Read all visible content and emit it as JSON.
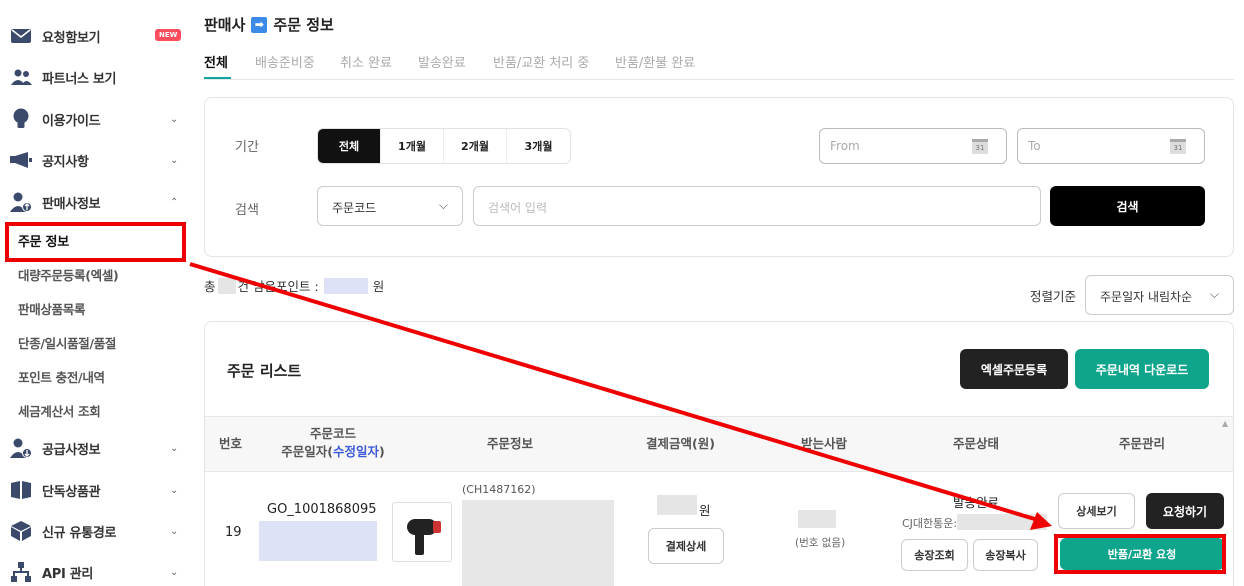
{
  "sidebar": {
    "items": [
      {
        "label": "요청함보기",
        "icon": "envelope-icon",
        "badge": "NEW"
      },
      {
        "label": "파트너스 보기",
        "icon": "people-icon"
      },
      {
        "label": "이용가이드",
        "icon": "lightbulb-icon",
        "chevron": "⌄"
      },
      {
        "label": "공지사항",
        "icon": "megaphone-icon",
        "chevron": "⌄"
      },
      {
        "label": "판매사정보",
        "icon": "user-up-icon",
        "chevron": "⌃"
      },
      {
        "label": "공급사정보",
        "icon": "user-down-icon",
        "chevron": "⌄"
      },
      {
        "label": "단독상품관",
        "icon": "bookmark-icon",
        "chevron": "⌄"
      },
      {
        "label": "신규 유통경로",
        "icon": "box-icon",
        "chevron": "⌄"
      },
      {
        "label": "API 관리",
        "icon": "network-icon",
        "chevron": "⌄"
      }
    ],
    "sub_items": [
      "주문 정보",
      "대량주문등록(엑셀)",
      "판매상품목록",
      "단종/일시품절/품절",
      "포인트 충전/내역",
      "세금계산서 조회"
    ]
  },
  "header": {
    "title_left": "판매사",
    "title_arrow": "➡",
    "title_right": "주문 정보"
  },
  "tabs": [
    "전체",
    "배송준비중",
    "취소 완료",
    "발송완료",
    "반품/교환 처리 중",
    "반품/환불 완료"
  ],
  "filter": {
    "period_label": "기간",
    "period_options": [
      "전체",
      "1개월",
      "2개월",
      "3개월"
    ],
    "from_placeholder": "From",
    "to_placeholder": "To",
    "calendar_day": "31",
    "search_label": "검색",
    "search_type": "주문코드",
    "search_placeholder": "검색어 입력",
    "search_button": "검색"
  },
  "summary": {
    "prefix": "총",
    "middle": "건 남은포인트 :",
    "suffix": "원"
  },
  "sort": {
    "label": "정렬기준",
    "value": "주문일자 내림차순"
  },
  "list": {
    "title": "주문 리스트",
    "excel_button": "엑셀주문등록",
    "download_button": "주문내역 다운로드",
    "headers": {
      "no": "번호",
      "code_line1": "주문코드",
      "code_line2": "주문일자(",
      "code_mod": "수정일자",
      "code_close": ")",
      "info": "주문정보",
      "amount": "결제금액(원)",
      "receiver": "받는사람",
      "status": "주문상태",
      "manage": "주문관리"
    },
    "rows": [
      {
        "no": "19",
        "order_code": "GO_1001868095",
        "product_code": "(CH1487162)",
        "amount_suffix": "원",
        "payment_detail": "결제상세",
        "receiver_note": "(번호 없음)",
        "status": "발송완료",
        "carrier": "CJ대한통운:",
        "track_button": "송장조회",
        "copy_button": "송장복사",
        "detail_button": "상세보기",
        "request_button": "요청하기",
        "return_button": "반품/교환 요청"
      }
    ]
  },
  "colors": {
    "accent": "#0fa5a0",
    "highlight": "#e00000",
    "download": "#0fa58c",
    "new_badge": "#ff4d5e"
  }
}
